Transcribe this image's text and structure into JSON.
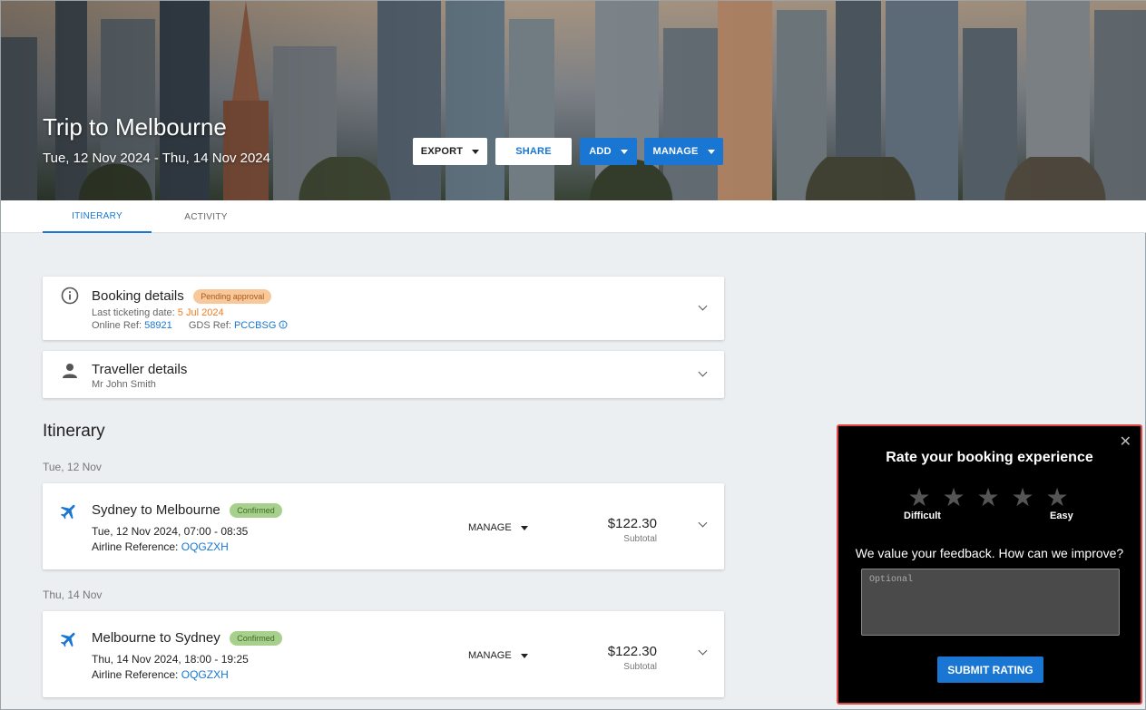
{
  "header": {
    "trip_title": "Trip to Melbourne",
    "trip_dates": "Tue, 12 Nov 2024 - Thu, 14 Nov 2024",
    "export_label": "EXPORT",
    "share_label": "SHARE",
    "add_label": "ADD",
    "manage_label": "MANAGE"
  },
  "tabs": [
    {
      "label": "ITINERARY",
      "active": true
    },
    {
      "label": "ACTIVITY",
      "active": false
    }
  ],
  "booking": {
    "title": "Booking details",
    "status": "Pending approval",
    "last_ticketing_label": "Last ticketing date:",
    "last_ticketing_date": "5 Jul 2024",
    "online_ref_label": "Online Ref:",
    "online_ref": "58921",
    "gds_ref_label": "GDS Ref:",
    "gds_ref": "PCCBSG"
  },
  "traveller": {
    "title": "Traveller details",
    "name": "Mr John Smith"
  },
  "itinerary": {
    "title": "Itinerary",
    "days": [
      {
        "date_label": "Tue, 12 Nov",
        "segment": {
          "route": "Sydney to Melbourne",
          "status": "Confirmed",
          "datetime": "Tue, 12 Nov 2024, 07:00 - 08:35",
          "airline_ref_label": "Airline Reference:",
          "airline_ref": "OQGZXH",
          "manage_label": "MANAGE",
          "price": "$122.30",
          "price_label": "Subtotal"
        }
      },
      {
        "date_label": "Thu, 14 Nov",
        "segment": {
          "route": "Melbourne to Sydney",
          "status": "Confirmed",
          "datetime": "Thu, 14 Nov 2024, 18:00 - 19:25",
          "airline_ref_label": "Airline Reference:",
          "airline_ref": "OQGZXH",
          "manage_label": "MANAGE",
          "price": "$122.30",
          "price_label": "Subtotal"
        }
      }
    ]
  },
  "rating_panel": {
    "close_glyph": "✕",
    "title": "Rate your booking experience",
    "star_glyph": "★",
    "star_count": 5,
    "label_low": "Difficult",
    "label_high": "Easy",
    "question": "We value your feedback. How can we improve?",
    "placeholder": "Optional",
    "submit_label": "SUBMIT RATING"
  },
  "colors": {
    "accent": "#1976d2",
    "pending_badge": "#f8c89a",
    "confirmed_badge": "#a8d08d",
    "highlight_border": "#e04848"
  }
}
